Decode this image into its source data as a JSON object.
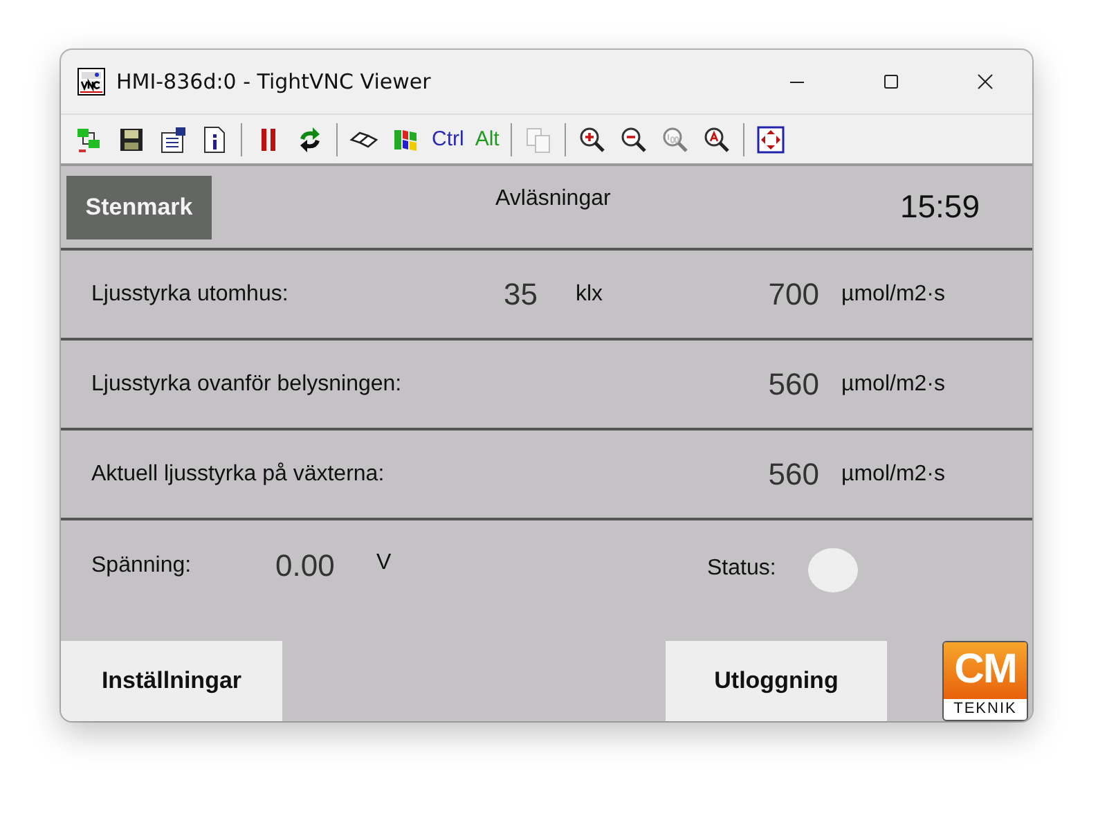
{
  "window": {
    "title": "HMI-836d:0 - TightVNC Viewer"
  },
  "toolbar": [
    {
      "kind": "connection",
      "disabled": false
    },
    {
      "kind": "save",
      "disabled": false
    },
    {
      "kind": "options",
      "disabled": false
    },
    {
      "kind": "info",
      "disabled": false
    },
    {
      "kind": "separator"
    },
    {
      "kind": "pause",
      "disabled": false
    },
    {
      "kind": "refresh",
      "disabled": false
    },
    {
      "kind": "separator"
    },
    {
      "kind": "keys",
      "disabled": false
    },
    {
      "kind": "windows",
      "disabled": false
    },
    {
      "kind": "text",
      "label": "Ctrl",
      "color": "#2a2ab0",
      "disabled": false
    },
    {
      "kind": "text",
      "label": "Alt",
      "color": "#1e9a1e",
      "disabled": false
    },
    {
      "kind": "separator"
    },
    {
      "kind": "copy",
      "disabled": true
    },
    {
      "kind": "separator"
    },
    {
      "kind": "zoom-in",
      "disabled": false
    },
    {
      "kind": "zoom-out",
      "disabled": false
    },
    {
      "kind": "zoom-100",
      "disabled": true
    },
    {
      "kind": "zoom-auto",
      "disabled": false
    },
    {
      "kind": "separator"
    },
    {
      "kind": "fullscreen",
      "disabled": false
    }
  ],
  "header": {
    "site_button": "Stenmark",
    "title": "Avläsningar",
    "time": "15:59"
  },
  "readings": [
    {
      "label": "Ljusstyrka utomhus:",
      "value_1": "35",
      "unit_1": "klx",
      "value_2": "700",
      "unit_2": "µmol/m2·s"
    },
    {
      "label": "Ljusstyrka ovanför belysningen:",
      "value_2": "560",
      "unit_2": "µmol/m2·s"
    },
    {
      "label": "Aktuell ljusstyrka på växterna:",
      "value_2": "560",
      "unit_2": "µmol/m2·s"
    }
  ],
  "voltage": {
    "label": "Spänning:",
    "value": "0.00",
    "unit": "V"
  },
  "status": {
    "label": "Status:",
    "color": "#efefef"
  },
  "buttons": [
    {
      "label": "Inställningar"
    },
    {
      "label": "Utloggning"
    }
  ],
  "logo": {
    "top": "CM",
    "bottom": "TEKNIK"
  }
}
